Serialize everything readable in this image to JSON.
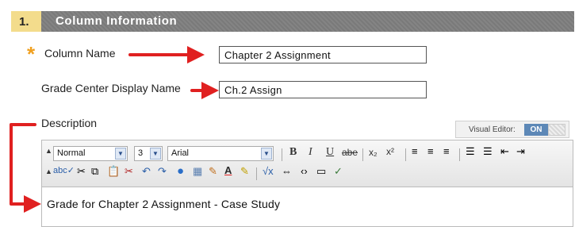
{
  "section": {
    "number": "1.",
    "title": "Column Information"
  },
  "required_star": "*",
  "column_name": {
    "label": "Column Name",
    "value": "Chapter 2 Assignment"
  },
  "display_name": {
    "label": "Grade Center Display Name",
    "value": "Ch.2 Assign"
  },
  "description": {
    "label": "Description",
    "visual_editor": {
      "label": "Visual Editor:",
      "state": "ON"
    },
    "toolbar": {
      "style_select": "Normal",
      "size_select": "3",
      "font_select": "Arial",
      "bold": "B",
      "italic": "I",
      "underline": "U",
      "strike": "abe",
      "subscript": "x₂",
      "superscript": "x²"
    },
    "content": "Grade for Chapter 2 Assignment - Case Study"
  },
  "colors": {
    "header": "#7f7f7f",
    "number_bg": "#f3dc8c",
    "arrow": "#e02020",
    "accent": "#5d88b7"
  }
}
